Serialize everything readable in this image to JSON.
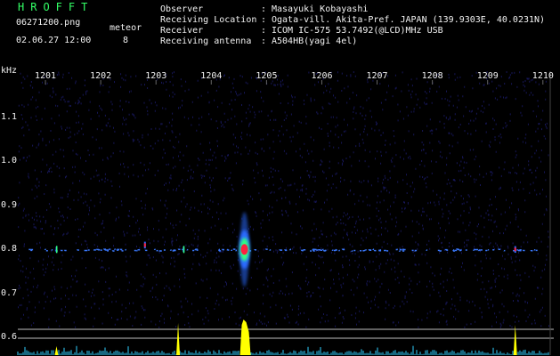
{
  "header": {
    "logo": "HROFFT",
    "filename": "06271200.png",
    "datetime": "02.06.27 12:00",
    "meteor_label": "meteor",
    "meteor_count": "8",
    "fields": [
      {
        "label": "Observer",
        "value": "Masayuki Kobayashi"
      },
      {
        "label": "Receiving Location",
        "value": "Ogata-vill. Akita-Pref. JAPAN (139.9303E, 40.0231N)"
      },
      {
        "label": "Receiver",
        "value": "ICOM IC-575 53.7492(@LCD)MHz USB"
      },
      {
        "label": "Receiving antenna",
        "value": "A504HB(yagi 4el)"
      }
    ]
  },
  "colors": {
    "background": "#000000",
    "text": "#f2f2f2",
    "logo": "#33ff66",
    "noise": "#1a1a66",
    "echo_core": "#ff2040",
    "echo_mid": "#30ff80",
    "echo_outer": "#2a6aff",
    "amplitude": "#ffff00",
    "baseline": "#30d0ff",
    "threshold": "#bfbfbf"
  },
  "chart_data": {
    "type": "heatmap",
    "ylabel": "kHz",
    "x_ticks": [
      "1201",
      "1202",
      "1203",
      "1204",
      "1205",
      "1206",
      "1207",
      "1208",
      "1209",
      "1210"
    ],
    "x_range": [
      1200.5,
      1210.1
    ],
    "y_ticks": [
      "1.1",
      "1.0",
      "0.9",
      "0.8",
      "0.7",
      "0.6"
    ],
    "y_range": [
      0.56,
      1.205
    ],
    "carrier_khz": 0.8,
    "meteor_echoes": [
      {
        "time": 1204.6,
        "freq_khz": 0.8,
        "strength": 1.0
      },
      {
        "time": 1202.8,
        "freq_khz": 0.81,
        "strength": 0.35
      },
      {
        "time": 1209.5,
        "freq_khz": 0.8,
        "strength": 0.35
      },
      {
        "time": 1201.2,
        "freq_khz": 0.8,
        "strength": 0.2
      },
      {
        "time": 1203.5,
        "freq_khz": 0.8,
        "strength": 0.15
      }
    ],
    "amplitude_spikes": [
      {
        "time": 1203.4,
        "level": 0.9
      },
      {
        "time": 1204.6,
        "level": 1.0
      },
      {
        "time": 1209.5,
        "level": 0.85
      },
      {
        "time": 1201.2,
        "level": 0.25
      }
    ]
  }
}
